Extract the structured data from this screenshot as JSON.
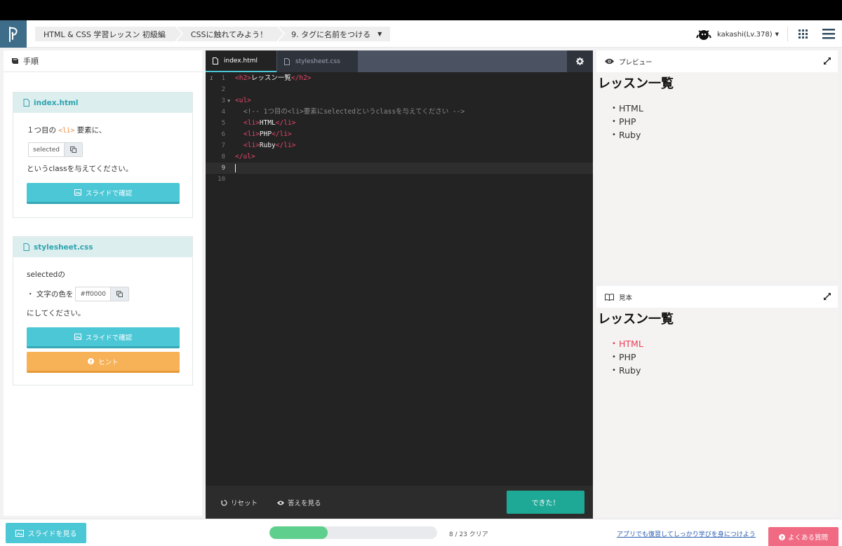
{
  "header": {
    "breadcrumbs": [
      "HTML & CSS 学習レッスン 初級編",
      "CSSに触れてみよう！",
      "9. タグに名前をつける"
    ],
    "user": "kakashi(Lv.378)"
  },
  "left": {
    "title": "手順",
    "card1": {
      "file": "index.html",
      "line1_pre": "１つ目の",
      "tag": "<li>",
      "line1_post": "要素に、",
      "copy_value": "selected",
      "line3": "というclassを与えてください。",
      "slide_label": "スライドで確認"
    },
    "card2": {
      "file": "stylesheet.css",
      "line1": "selectedの",
      "line2_pre": "・ 文字の色を",
      "copy_value": "#ff0000",
      "line3": "にしてください。",
      "slide_label": "スライドで確認",
      "hint_label": "ヒント"
    }
  },
  "editor": {
    "tabs": [
      "index.html",
      "stylesheet.css"
    ],
    "line_numbers": [
      "1",
      "2",
      "3",
      "4",
      "5",
      "6",
      "7",
      "8",
      "9",
      "10"
    ],
    "code": {
      "l1_open": "<h2>",
      "l1_text": "レッスン一覧",
      "l1_close": "</h2>",
      "l3": "<ul>",
      "l4": "<!-- 1つ目の<li>要素にselectedというclassを与えてください -->",
      "l5_open": "<li>",
      "l5_text": "HTML",
      "l5_close": "</li>",
      "l6_open": "<li>",
      "l6_text": "PHP",
      "l6_close": "</li>",
      "l7_open": "<li>",
      "l7_text": "Ruby",
      "l7_close": "</li>",
      "l8": "</ul>"
    },
    "reset_label": "リセット",
    "answer_label": "答えを見る",
    "done_label": "できた！"
  },
  "preview": {
    "title": "プレビュー",
    "heading": "レッスン一覧",
    "items": [
      "HTML",
      "PHP",
      "Ruby"
    ]
  },
  "sample": {
    "title": "見本",
    "heading": "レッスン一覧",
    "items": [
      "HTML",
      "PHP",
      "Ruby"
    ],
    "selected_color": "#ef3b58"
  },
  "bottom": {
    "slides_label": "スライドを見る",
    "progress_text": "8 / 23 クリア",
    "progress_fraction": 0.348,
    "app_link": "アプリでも復習してしっかり学びを身につけよう",
    "faq_label": "よくある質問"
  }
}
